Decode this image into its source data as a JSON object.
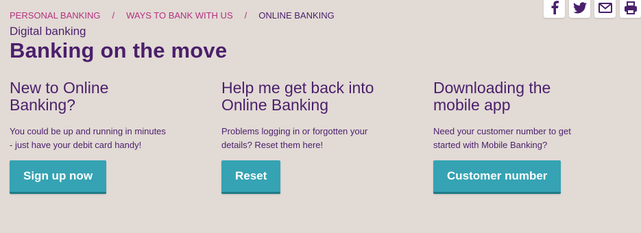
{
  "breadcrumb": {
    "items": [
      "Personal Banking",
      "Ways to bank with us"
    ],
    "separator": "/",
    "current": "Online Banking"
  },
  "share": {
    "icons": [
      "facebook-icon",
      "twitter-icon",
      "email-icon",
      "print-icon"
    ]
  },
  "header": {
    "kicker": "Digital banking",
    "title": "Banking on the move"
  },
  "cards": [
    {
      "title_line1": "New to Online",
      "title_line2": "Banking?",
      "text_line1": "You could be up and running in minutes",
      "text_line2": "- just have your debit card handy!",
      "button": "Sign up now"
    },
    {
      "title_line1": "Help me get back into",
      "title_line2": "Online Banking",
      "text_line1": "Problems logging in or forgotten your",
      "text_line2": "details? Reset them here!",
      "button": "Reset"
    },
    {
      "title_line1": "Downloading the",
      "title_line2": "mobile app",
      "text_line1": "Need your customer number to get",
      "text_line2": "started with Mobile Banking?",
      "button": "Customer number"
    }
  ],
  "colors": {
    "background": "#e2dad5",
    "brand_purple": "#4a1f6b",
    "link_magenta": "#b3317f",
    "button_teal": "#35a3b3"
  }
}
